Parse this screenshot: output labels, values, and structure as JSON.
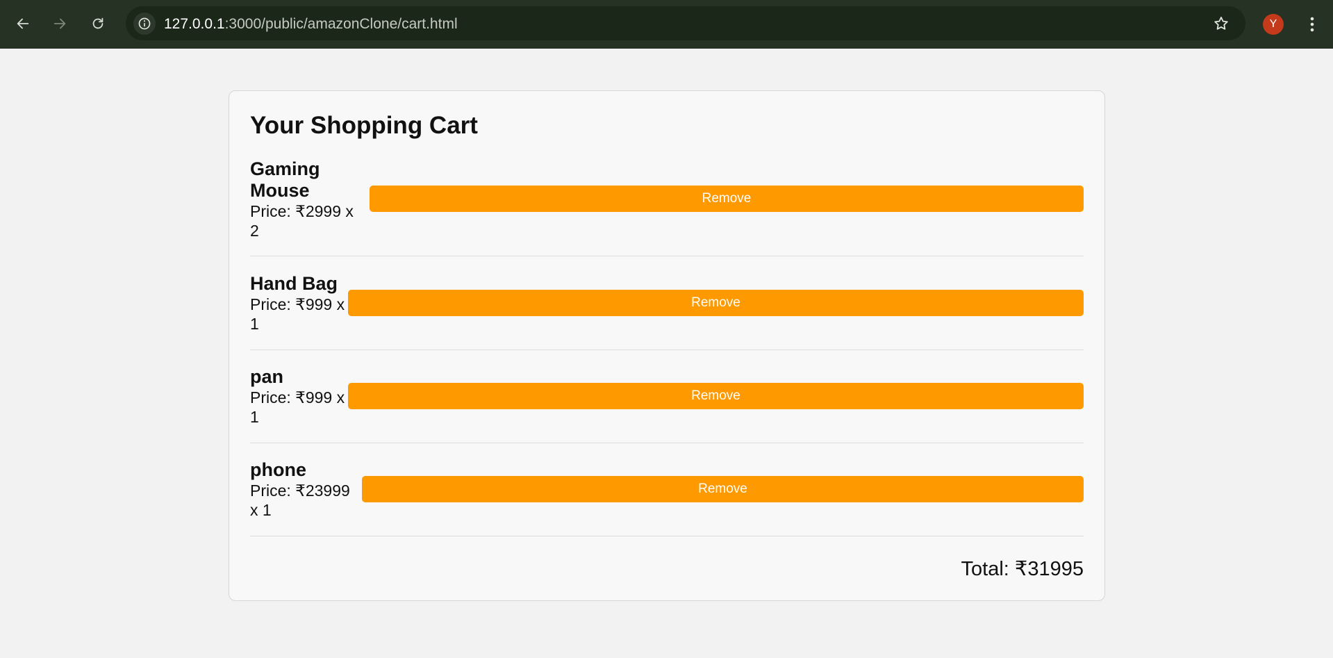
{
  "browser": {
    "url_host": "127.0.0.1",
    "url_path": ":3000/public/amazonClone/cart.html",
    "profile_initial": "Y",
    "icons": {
      "back": "arrow-left-icon",
      "forward": "arrow-right-icon",
      "reload": "reload-icon",
      "site_info": "info-icon",
      "bookmark": "star-icon",
      "menu": "kebab-menu-icon"
    }
  },
  "cart": {
    "title": "Your Shopping Cart",
    "items": [
      {
        "name_line1": "Gaming",
        "name_line2": "Mouse",
        "price_line1": "Price: ₹2999 x",
        "price_line2": "2",
        "remove_label": "Remove"
      },
      {
        "name_line1": "Hand Bag",
        "price_line1": "Price: ₹999 x",
        "price_line2": "1",
        "remove_label": "Remove"
      },
      {
        "name_line1": "pan",
        "price_line1": "Price: ₹999 x",
        "price_line2": "1",
        "remove_label": "Remove"
      },
      {
        "name_line1": "phone",
        "price_line1": "Price: ₹23999",
        "price_line2": "x 1",
        "remove_label": "Remove"
      }
    ],
    "total_label": "Total: ₹31995"
  },
  "colors": {
    "accent": "#ff9900",
    "chrome_bg": "#263224",
    "avatar": "#c43a1a"
  }
}
